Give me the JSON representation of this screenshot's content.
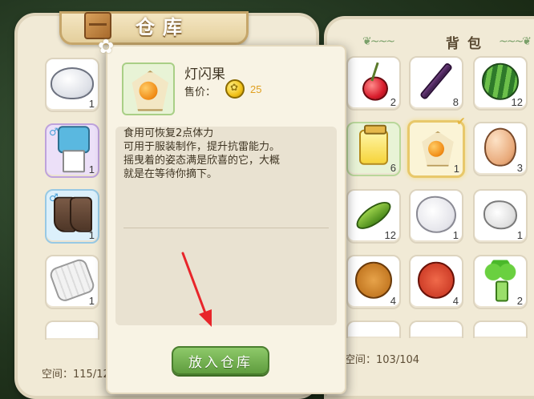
{
  "warehouse": {
    "title": "仓库",
    "space": "空间：115/12",
    "slots": [
      {
        "item": "rice",
        "count": "1",
        "style": "",
        "gender": ""
      },
      {
        "item": "outfit",
        "count": "1",
        "style": "purple",
        "gender": "♂"
      },
      {
        "item": "boots",
        "count": "1",
        "style": "blue",
        "gender": "♂"
      },
      {
        "item": "roll",
        "count": "1",
        "style": "",
        "gender": ""
      }
    ]
  },
  "backpack": {
    "title": "背包",
    "space": "空间：103/104",
    "slots": [
      {
        "item": "cherry",
        "count": "2"
      },
      {
        "item": "stick",
        "count": "8"
      },
      {
        "item": "watermelon",
        "count": "12"
      },
      {
        "item": "honey-jar",
        "count": "6"
      },
      {
        "item": "physalis",
        "count": "1"
      },
      {
        "item": "egg",
        "count": "3"
      },
      {
        "item": "pea-pod",
        "count": "12"
      },
      {
        "item": "cotton",
        "count": "1"
      },
      {
        "item": "wool",
        "count": "1"
      },
      {
        "item": "cookie-brown",
        "count": "4"
      },
      {
        "item": "cookie-red",
        "count": "4"
      },
      {
        "item": "broccoli",
        "count": "2"
      }
    ]
  },
  "popup": {
    "item_name": "灯闪果",
    "price_label": "售价：",
    "price_value": "25",
    "description": "食用可恢复2点体力\n可用于服装制作，提升抗雷能力。\n摇曳着的姿态满是欣喜的它，大概\n就是在等待你摘下。",
    "button_label": "放入仓库",
    "icon": "physalis"
  },
  "colors": {
    "panel": "#f1ead6",
    "button_green": "#6fab4c",
    "price_gold": "#e0a020",
    "annotation_red": "#e8252a"
  }
}
